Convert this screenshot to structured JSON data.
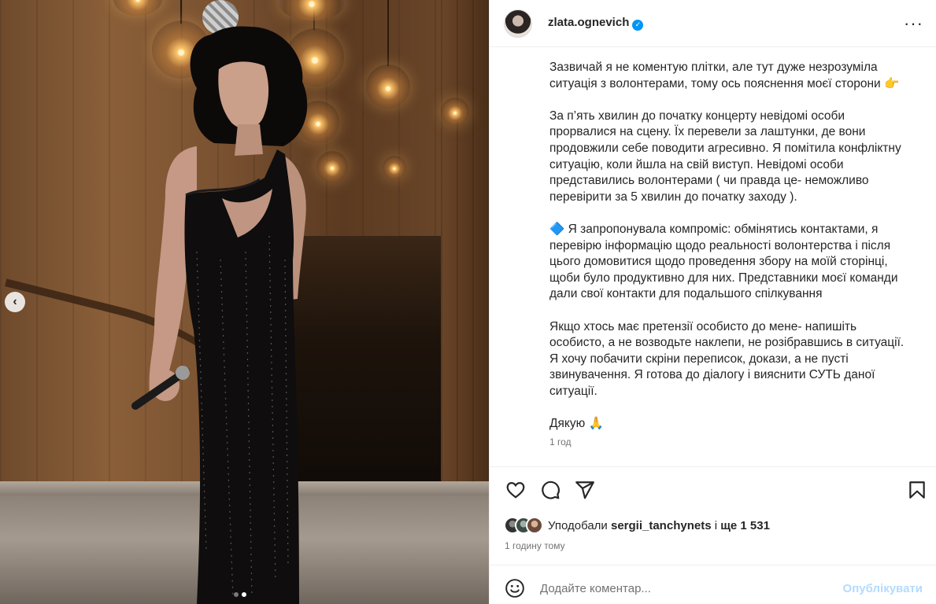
{
  "post": {
    "carousel": {
      "total": 2,
      "current": 2,
      "prev_icon": "chevron-left-icon"
    },
    "author": {
      "username": "zlata.ognevich",
      "verified": true
    },
    "caption": [
      "Зазвичай я не коментую плітки, але тут дуже незрозуміла\nситуація з волонтерами, тому ось пояснення моєї сторони 👉",
      "За п’ять хвилин до початку концерту невідомі особи\nпрорвалися на сцену. Їх перевели за лаштунки, де вони\nпродовжили себе поводити агресивно. Я помітила конфліктну\nситуацію, коли йшла на свій виступ. Невідомі особи\nпредставились волонтерами ( чи правда це- неможливо\nперевірити за 5 хвилин до початку заходу ).",
      "🔷 Я запропонувала компроміс: обмінятись контактами, я\nперевірю інформацію щодо реальності волонтерства і після\nцього домовитися щодо проведення збору на моїй сторінці,\nщоби було продуктивно для них. Представники моєї команди\nдали свої контакти для подальшого спілкування",
      "Якщо хтось має претензії особисто до мене- напишіть\nособисто, а не возводьте наклепи, не розібравшись в ситуації.\nЯ хочу побачити скріни переписок, докази, а не пусті\nзвинувачення. Я готова до діалогу і вияснити СУТЬ даної\nситуації.",
      "Дякую 🙏"
    ],
    "caption_time": "1 год",
    "likes": {
      "prefix": "Уподобали",
      "user": "sergii_tanchynets",
      "middle": "і",
      "count_text": "ще 1 531"
    },
    "posted_ago": "1 годину тому",
    "comment": {
      "placeholder": "Додайте коментар...",
      "publish_label": "Опублікувати"
    },
    "colors": {
      "accent": "#0095f6",
      "publish_disabled": "#b3dbff",
      "secondary_text": "#737373",
      "divider": "#efefef"
    },
    "icons": [
      "more-options-icon",
      "verified-badge-icon",
      "heart-icon",
      "comment-icon",
      "share-icon",
      "bookmark-icon",
      "emoji-icon"
    ]
  }
}
